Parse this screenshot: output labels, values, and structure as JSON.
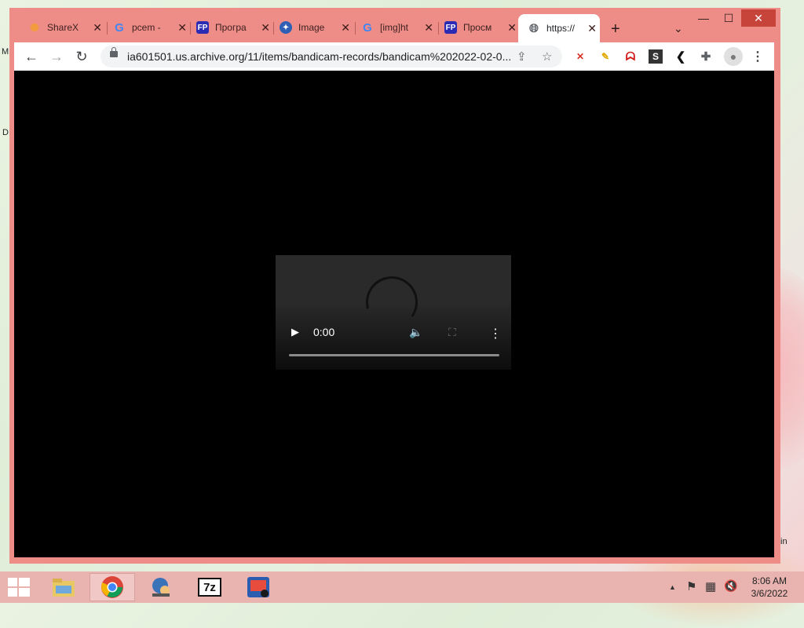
{
  "desktop": {
    "left_letters": [
      "M",
      "D"
    ],
    "right_label": "in"
  },
  "browser": {
    "tabs": [
      {
        "title": "ShareX",
        "icon": "sharex-icon",
        "fav_color": "#f39c3c"
      },
      {
        "title": "pcem -",
        "icon": "google-icon",
        "fav_color": "#4285f4"
      },
      {
        "title": "Програ",
        "icon": "fp-icon",
        "fav_color": "#2b2bb3"
      },
      {
        "title": "Image",
        "icon": "globe-compass-icon",
        "fav_color": "#2f5fb5"
      },
      {
        "title": "[img]ht",
        "icon": "google-icon",
        "fav_color": "#4285f4"
      },
      {
        "title": "Просм",
        "icon": "fp-icon",
        "fav_color": "#2b2bb3"
      },
      {
        "title": "https://",
        "icon": "globe-icon",
        "fav_color": "#5f6368"
      }
    ],
    "tab_close_glyph": "✕",
    "new_tab_glyph": "+",
    "tab_search_glyph": "⌄",
    "window_controls": {
      "minimize": "—",
      "maximize": "☐",
      "close": "✕"
    },
    "url": "ia601501.us.archive.org/11/items/bandicam-records/bandicam%202022-02-0...",
    "nav": {
      "back": "←",
      "forward": "→",
      "reload": "↻"
    },
    "extensions": [
      {
        "name": "shield-extension-icon",
        "glyph": "✕",
        "color": "#d93025"
      },
      {
        "name": "pencil-extension-icon",
        "glyph": "✎",
        "color": "#e0a800"
      },
      {
        "name": "ghost-extension-icon",
        "glyph": "ᗣ",
        "color": "#d01818"
      },
      {
        "name": "s-extension-icon",
        "glyph": "S",
        "color": "#333333"
      },
      {
        "name": "chevron-extension-icon",
        "glyph": "❮",
        "color": "#111111"
      },
      {
        "name": "puzzle-extensions-icon",
        "glyph": "✚",
        "color": "#5f6368"
      },
      {
        "name": "profile-icon",
        "glyph": "●",
        "color": "#7a7a7a"
      },
      {
        "name": "menu-kebab-icon",
        "glyph": "⋮",
        "color": "#3c4043"
      }
    ]
  },
  "player": {
    "time": "0:00",
    "play_glyph": "▶",
    "volume_glyph": "🔈",
    "fullscreen_glyph": "⛶",
    "more_glyph": "⋮",
    "progress": 0
  },
  "taskbar": {
    "apps": [
      {
        "name": "file-explorer-icon",
        "active": false
      },
      {
        "name": "chrome-icon",
        "active": true
      },
      {
        "name": "network-app-icon",
        "active": false
      },
      {
        "name": "7zip-icon",
        "label": "7z",
        "active": false
      },
      {
        "name": "installer-icon",
        "active": false
      }
    ],
    "time": "8:06 AM",
    "date": "3/6/2022",
    "tray_glyphs": {
      "chevron": "▲",
      "flag": "⚑",
      "network": "▦",
      "volume": "🔇"
    }
  }
}
